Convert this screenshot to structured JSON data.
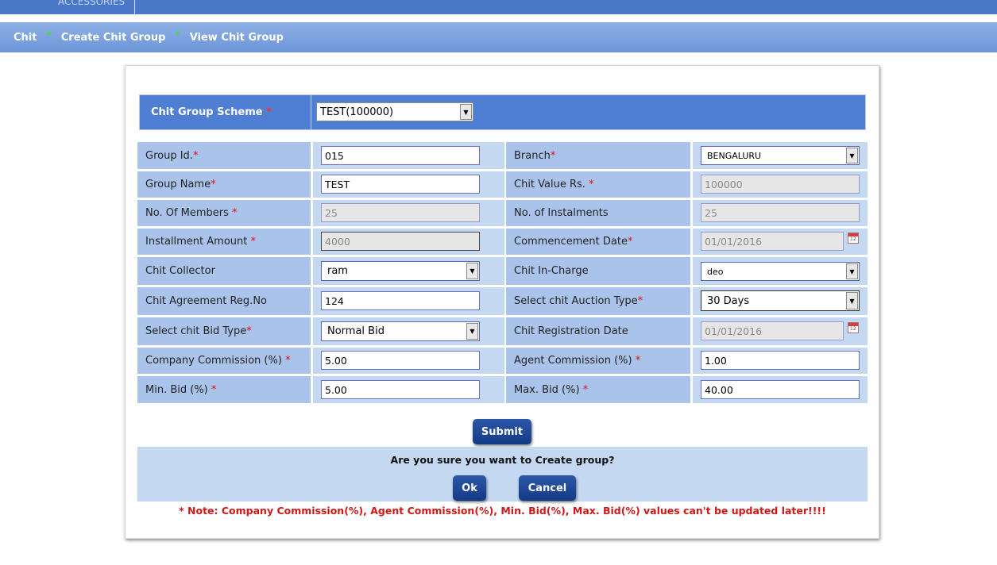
{
  "topbar": {
    "menu_item": "ACCESSORIES"
  },
  "breadcrumb": {
    "items": [
      "Chit",
      "Create Chit Group",
      "View Chit Group"
    ],
    "separator": "*"
  },
  "form": {
    "scheme": {
      "label": "Chit Group Scheme",
      "value": "TEST(100000)"
    },
    "required_mark": "*",
    "fields": {
      "group_id": {
        "label": "Group Id.",
        "value": "015"
      },
      "branch": {
        "label": "Branch",
        "value": "BENGALURU"
      },
      "group_name": {
        "label": "Group Name",
        "value": "TEST"
      },
      "chit_value": {
        "label": "Chit Value Rs.",
        "value": "100000"
      },
      "members": {
        "label": "No. Of Members",
        "value": "25"
      },
      "instalments": {
        "label": "No. of Instalments",
        "value": "25"
      },
      "installment_amount": {
        "label": "Installment Amount",
        "value": "4000"
      },
      "commencement_date": {
        "label": "Commencement Date",
        "value": "01/01/2016"
      },
      "collector": {
        "label": "Chit Collector",
        "value": "ram"
      },
      "in_charge": {
        "label": "Chit In-Charge",
        "value": "deo"
      },
      "agreement_reg": {
        "label": "Chit Agreement Reg.No",
        "value": "124"
      },
      "auction_type": {
        "label": "Select chit Auction Type",
        "value": "30 Days"
      },
      "bid_type": {
        "label": "Select chit Bid Type",
        "value": "Normal Bid"
      },
      "registration_date": {
        "label": "Chit Registration Date",
        "value": "01/01/2016"
      },
      "company_commission": {
        "label": "Company Commission (%)",
        "value": "5.00"
      },
      "agent_commission": {
        "label": "Agent Commission (%)",
        "value": "1.00"
      },
      "min_bid": {
        "label": "Min. Bid (%)",
        "value": "5.00"
      },
      "max_bid": {
        "label": "Max. Bid (%)",
        "value": "40.00"
      }
    },
    "submit_label": "Submit"
  },
  "confirm": {
    "question": "Are you sure you want to Create group?",
    "ok_label": "Ok",
    "cancel_label": "Cancel"
  },
  "note": "* Note: Company Commission(%), Agent Commission(%), Min. Bid(%), Max. Bid(%) values can't be updated later!!!!",
  "colors": {
    "topbar": "#4a78c8",
    "scheme_header": "#4e7fd4",
    "label_cell": "#a9c3ea",
    "value_cell": "#c5d8f1",
    "button": "#1e4796",
    "note": "#d01818",
    "required": "#e01010"
  },
  "icons": {
    "select_arrow": "chevron-down-icon",
    "date_picker": "calendar-icon",
    "breadcrumb_separator": "star-icon"
  }
}
